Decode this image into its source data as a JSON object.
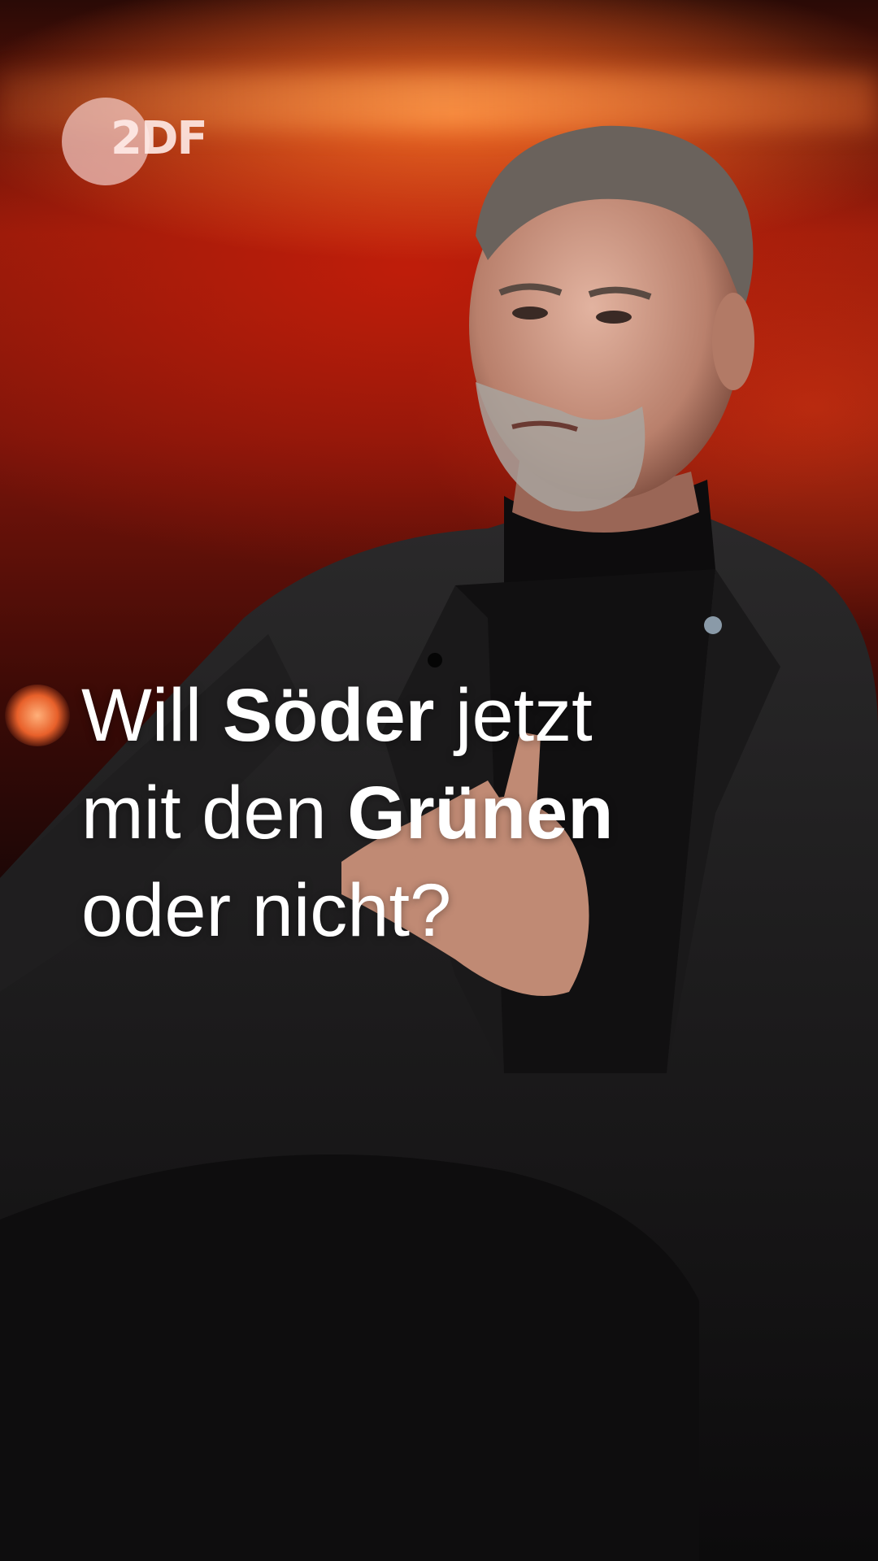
{
  "logo": {
    "text": "2DF",
    "icon": "zdf-logo-icon"
  },
  "headline": {
    "line1_a": "Will ",
    "line1_b": "Söder",
    "line1_c": " jetzt",
    "line2_a": "mit den ",
    "line2_b": "Grünen",
    "line3_a": "oder nicht?"
  },
  "colors": {
    "background_red": "#8e1a0a",
    "text": "#ffffff",
    "logo": "#f0c8c3"
  }
}
